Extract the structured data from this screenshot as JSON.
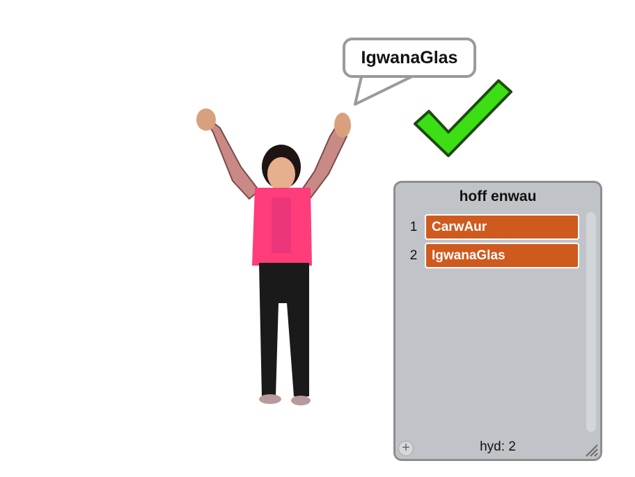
{
  "stage": {
    "speech_bubble": {
      "text": "IgwanaGlas"
    },
    "check_icon": {
      "icon": "green-checkmark-icon",
      "color": "#3cde14",
      "outline": "#1d4a12"
    }
  },
  "list_watcher": {
    "title": "hoff enwau",
    "items": [
      {
        "index": "1",
        "value": "CarwAur"
      },
      {
        "index": "2",
        "value": "IgwanaGlas"
      }
    ],
    "length_label": "hyd: 2",
    "add_icon": "plus-icon",
    "resize_icon": "resize-grip-icon",
    "item_color": "#cf5a1e"
  }
}
